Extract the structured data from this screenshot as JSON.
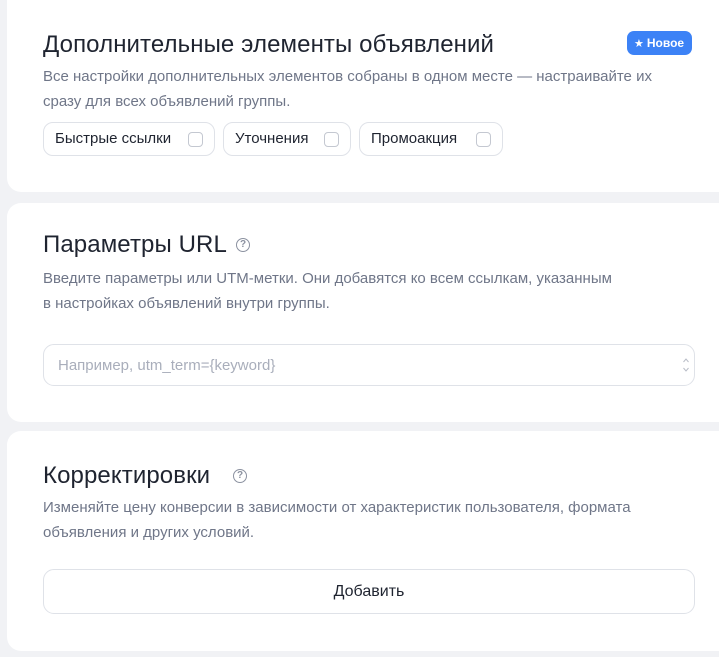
{
  "extras": {
    "title": "Дополнительные элементы объявлений",
    "badge_label": "Новое",
    "badge_icon": "star-icon",
    "description": "Все настройки дополнительных элементов собраны в одном месте — настраивайте их сразу для всех объявлений группы.",
    "chips": [
      {
        "label": "Быстрые ссылки",
        "checked": false
      },
      {
        "label": "Уточнения",
        "checked": false
      },
      {
        "label": "Промоакция",
        "checked": false
      }
    ]
  },
  "url_params": {
    "title": "Параметры URL",
    "help_icon": "question-circle-icon",
    "description_line1": "Введите параметры или UTM-метки. Они добавятся ко всем ссылкам, указанным",
    "description_line2": "в настройках объявлений внутри группы.",
    "input_value": "",
    "input_placeholder": "Например, utm_term={keyword}"
  },
  "adjustments": {
    "title": "Корректировки",
    "help_icon": "question-circle-icon",
    "description_line1": "Изменяйте цену конверсии в зависимости от характеристик пользователя, формата",
    "description_line2": "объявления и других условий.",
    "add_button_label": "Добавить"
  },
  "colors": {
    "page_background": "#f1f2f5",
    "card_background": "#ffffff",
    "badge_blue": "#3c82f6",
    "muted_text": "#6f7688",
    "border": "#dfe2e8"
  }
}
